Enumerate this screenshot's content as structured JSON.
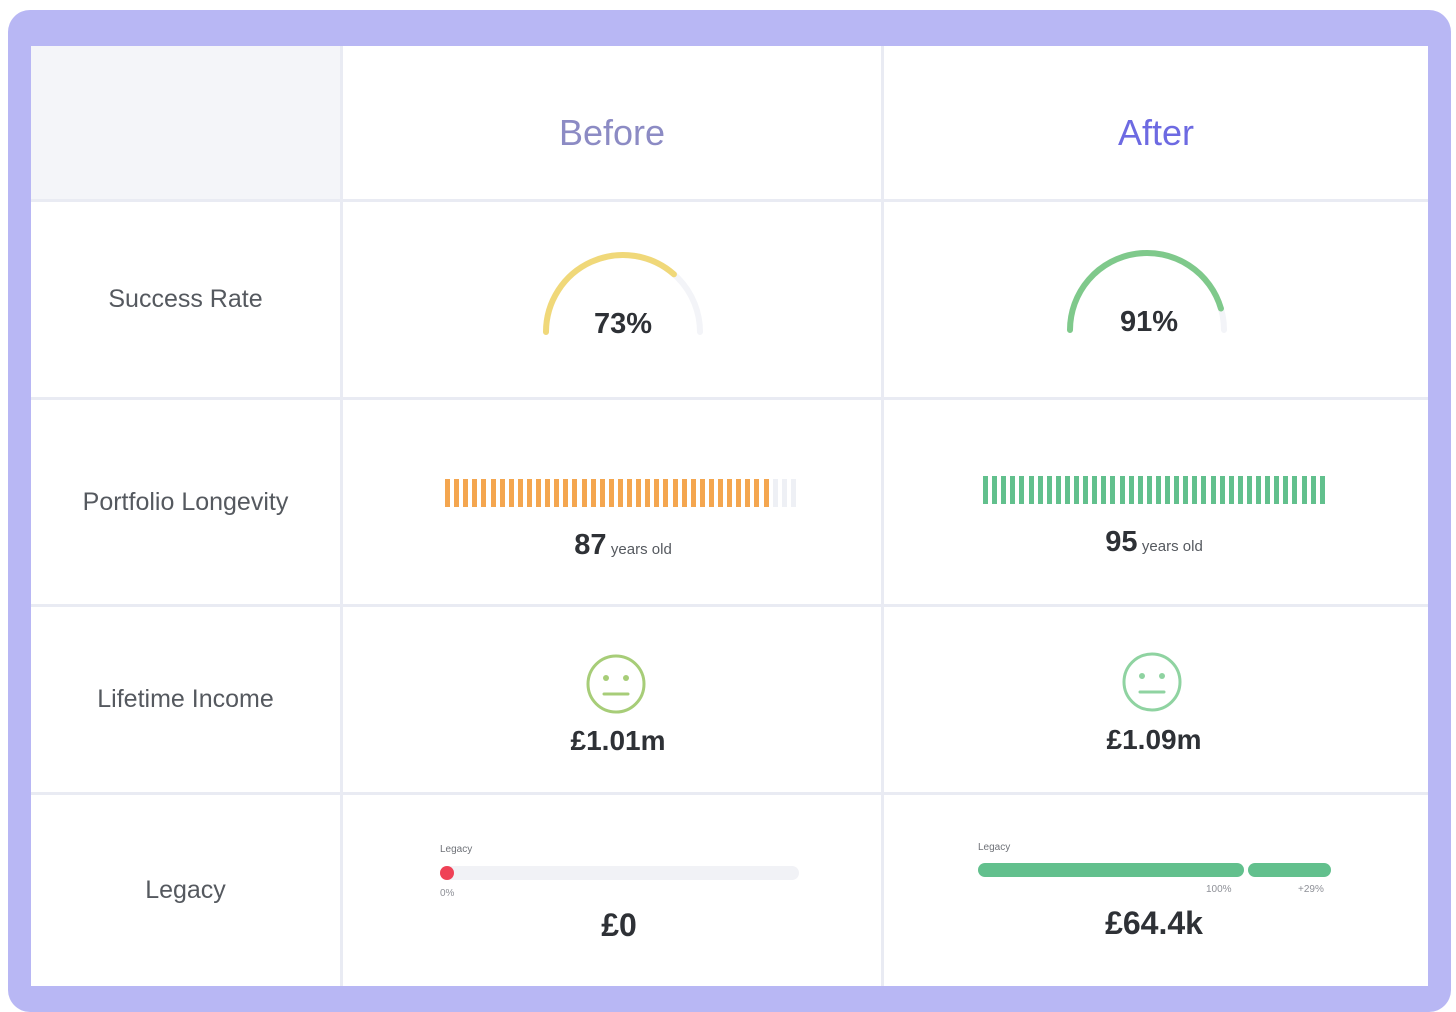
{
  "columns": {
    "before": {
      "title": "Before",
      "color": "#8c8bc4"
    },
    "after": {
      "title": "After",
      "color": "#6d6ae2"
    }
  },
  "rows": [
    {
      "label": "Success Rate"
    },
    {
      "label": "Portfolio Longevity"
    },
    {
      "label": "Lifetime Income"
    },
    {
      "label": "Legacy"
    }
  ],
  "before": {
    "success_rate": {
      "text": "73%",
      "fraction": 0.73,
      "color": "#f0d879"
    },
    "longevity": {
      "value": "87",
      "unit": "years old",
      "fill_fraction": 0.93,
      "color": "#f4a64f"
    },
    "income": {
      "value": "£1.01m",
      "icon": "neutral-face-icon",
      "color": "#a7cd78"
    },
    "legacy": {
      "caption": "Legacy",
      "scale_label": "0%",
      "value": "£0",
      "fill_fraction": 0,
      "dot_color": "#ef4156"
    }
  },
  "after": {
    "success_rate": {
      "text": "91%",
      "fraction": 0.91,
      "color": "#7fc98b"
    },
    "longevity": {
      "value": "95",
      "unit": "years old",
      "fill_fraction": 1.0,
      "color": "#62c08d"
    },
    "income": {
      "value": "£1.09m",
      "icon": "neutral-face-icon",
      "color": "#8fd3a1"
    },
    "legacy": {
      "caption": "Legacy",
      "label_100": "100%",
      "label_extra": "+29%",
      "value": "£64.4k",
      "fill_fraction": 1.29,
      "color": "#62c08d"
    }
  }
}
